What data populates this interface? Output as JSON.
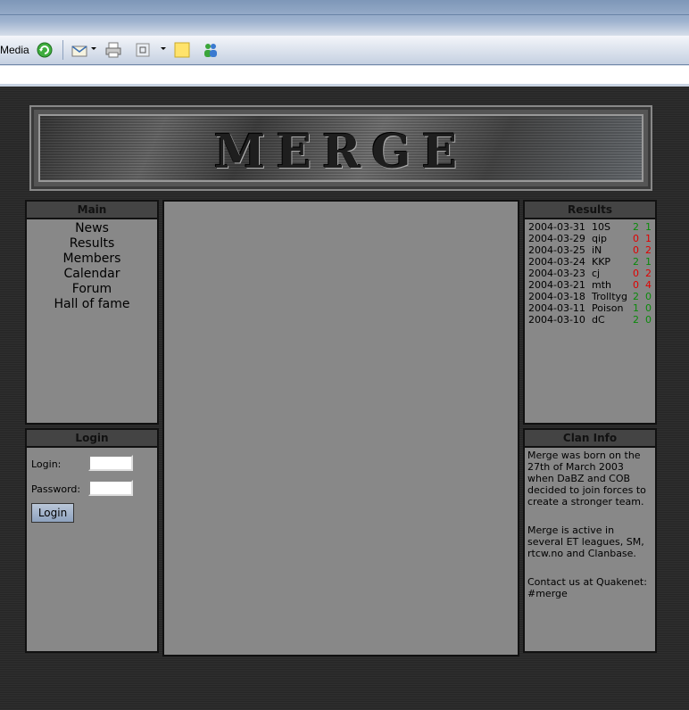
{
  "browser": {
    "toolbar": {
      "media_label": "Media",
      "icons": [
        "media-refresh-icon",
        "mail-icon",
        "print-icon",
        "edit-icon",
        "notes-icon",
        "messenger-icon"
      ]
    }
  },
  "site": {
    "banner_title": "MERGE",
    "main_menu": {
      "title": "Main",
      "items": [
        "News",
        "Results",
        "Members",
        "Calendar",
        "Forum",
        "Hall of fame"
      ]
    },
    "login": {
      "title": "Login",
      "login_label": "Login:",
      "password_label": "Password:",
      "button_label": "Login"
    },
    "results": {
      "title": "Results",
      "rows": [
        {
          "date": "2004-03-31",
          "opponent": "10S",
          "us": "2",
          "them": "1",
          "outcome": "win"
        },
        {
          "date": "2004-03-29",
          "opponent": "qip",
          "us": "0",
          "them": "1",
          "outcome": "loss"
        },
        {
          "date": "2004-03-25",
          "opponent": "iN",
          "us": "0",
          "them": "2",
          "outcome": "loss"
        },
        {
          "date": "2004-03-24",
          "opponent": "KKP",
          "us": "2",
          "them": "1",
          "outcome": "win"
        },
        {
          "date": "2004-03-23",
          "opponent": "cj",
          "us": "0",
          "them": "2",
          "outcome": "loss"
        },
        {
          "date": "2004-03-21",
          "opponent": "mth",
          "us": "0",
          "them": "4",
          "outcome": "loss"
        },
        {
          "date": "2004-03-18",
          "opponent": "Trolltyg",
          "us": "2",
          "them": "0",
          "outcome": "win"
        },
        {
          "date": "2004-03-11",
          "opponent": "Poison",
          "us": "1",
          "them": "0",
          "outcome": "win"
        },
        {
          "date": "2004-03-10",
          "opponent": "dC",
          "us": "2",
          "them": "0",
          "outcome": "win"
        }
      ]
    },
    "clan_info": {
      "title": "Clan Info",
      "paragraphs": [
        "Merge was born on the 27th of March 2003 when DaBZ and COB decided to join forces to create a stronger team.",
        "Merge is active in several ET leagues, SM, rtcw.no and Clanbase.",
        "Contact us at Quakenet: #merge"
      ]
    }
  },
  "colors": {
    "win": "#0a8a0a",
    "loss": "#e00000",
    "panel": "#888888",
    "panel_header": "#444444"
  }
}
